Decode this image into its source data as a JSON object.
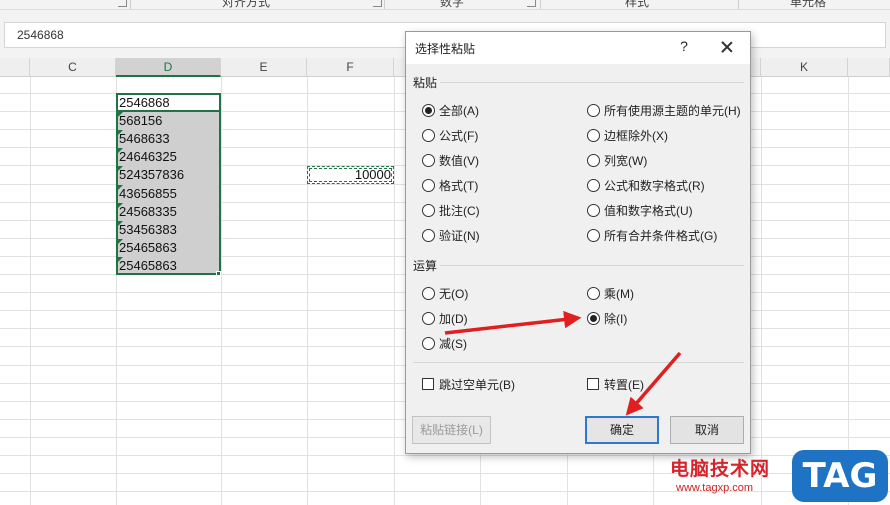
{
  "ribbon": {
    "groups": [
      "对齐方式",
      "数字",
      "样式",
      "单元格"
    ]
  },
  "formula_bar": {
    "value": "2546868"
  },
  "columns": [
    "C",
    "D",
    "E",
    "F",
    "",
    "",
    "",
    "K"
  ],
  "selected_column": "D",
  "cells": {
    "d_values": [
      "2546868",
      "568156",
      "5468633",
      "24646325",
      "524357836",
      "43656855",
      "24568335",
      "53456383",
      "25465863",
      "25465863"
    ],
    "copied_value": "10000"
  },
  "dialog": {
    "title": "选择性粘贴",
    "help": "?",
    "paste_section": "粘贴",
    "paste_options_left": [
      {
        "label": "全部(A)",
        "checked": true
      },
      {
        "label": "公式(F)",
        "checked": false
      },
      {
        "label": "数值(V)",
        "checked": false
      },
      {
        "label": "格式(T)",
        "checked": false
      },
      {
        "label": "批注(C)",
        "checked": false
      },
      {
        "label": "验证(N)",
        "checked": false
      }
    ],
    "paste_options_right": [
      {
        "label": "所有使用源主题的单元(H)",
        "checked": false
      },
      {
        "label": "边框除外(X)",
        "checked": false
      },
      {
        "label": "列宽(W)",
        "checked": false
      },
      {
        "label": "公式和数字格式(R)",
        "checked": false
      },
      {
        "label": "值和数字格式(U)",
        "checked": false
      },
      {
        "label": "所有合并条件格式(G)",
        "checked": false
      }
    ],
    "operation_section": "运算",
    "operation_options_left": [
      {
        "label": "无(O)",
        "checked": false
      },
      {
        "label": "加(D)",
        "checked": false
      },
      {
        "label": "减(S)",
        "checked": false
      }
    ],
    "operation_options_right": [
      {
        "label": "乘(M)",
        "checked": false
      },
      {
        "label": "除(I)",
        "checked": true
      }
    ],
    "skip_blanks_label": "跳过空单元(B)",
    "transpose_label": "转置(E)",
    "paste_link_label": "粘贴链接(L)",
    "ok_label": "确定",
    "cancel_label": "取消"
  },
  "annotation": {
    "arrow_color": "#e02020"
  },
  "watermark": {
    "site_name": "电脑技术网",
    "url": "www.tagxp.com",
    "tag": "TAG"
  }
}
